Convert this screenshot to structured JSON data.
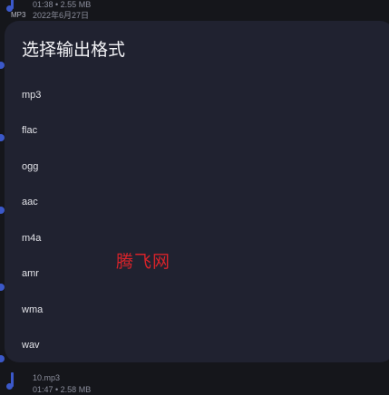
{
  "background_list": {
    "top_item": {
      "format_tag": "MP3",
      "meta_line": "01:38 • 2.55 MB",
      "date": "2022年6月27日"
    },
    "bottom_item": {
      "filename": "10.mp3",
      "meta_line": "01:47 • 2.58 MB"
    }
  },
  "dialog": {
    "title": "选择输出格式",
    "options": [
      {
        "label": "mp3"
      },
      {
        "label": "flac"
      },
      {
        "label": "ogg"
      },
      {
        "label": "aac"
      },
      {
        "label": "m4a"
      },
      {
        "label": "amr"
      },
      {
        "label": "wma"
      },
      {
        "label": "wav"
      }
    ]
  },
  "watermark": "腾飞网",
  "colors": {
    "background": "#15161b",
    "dialog_surface": "#202230",
    "accent": "#3b58c9",
    "watermark": "#d8232a"
  }
}
